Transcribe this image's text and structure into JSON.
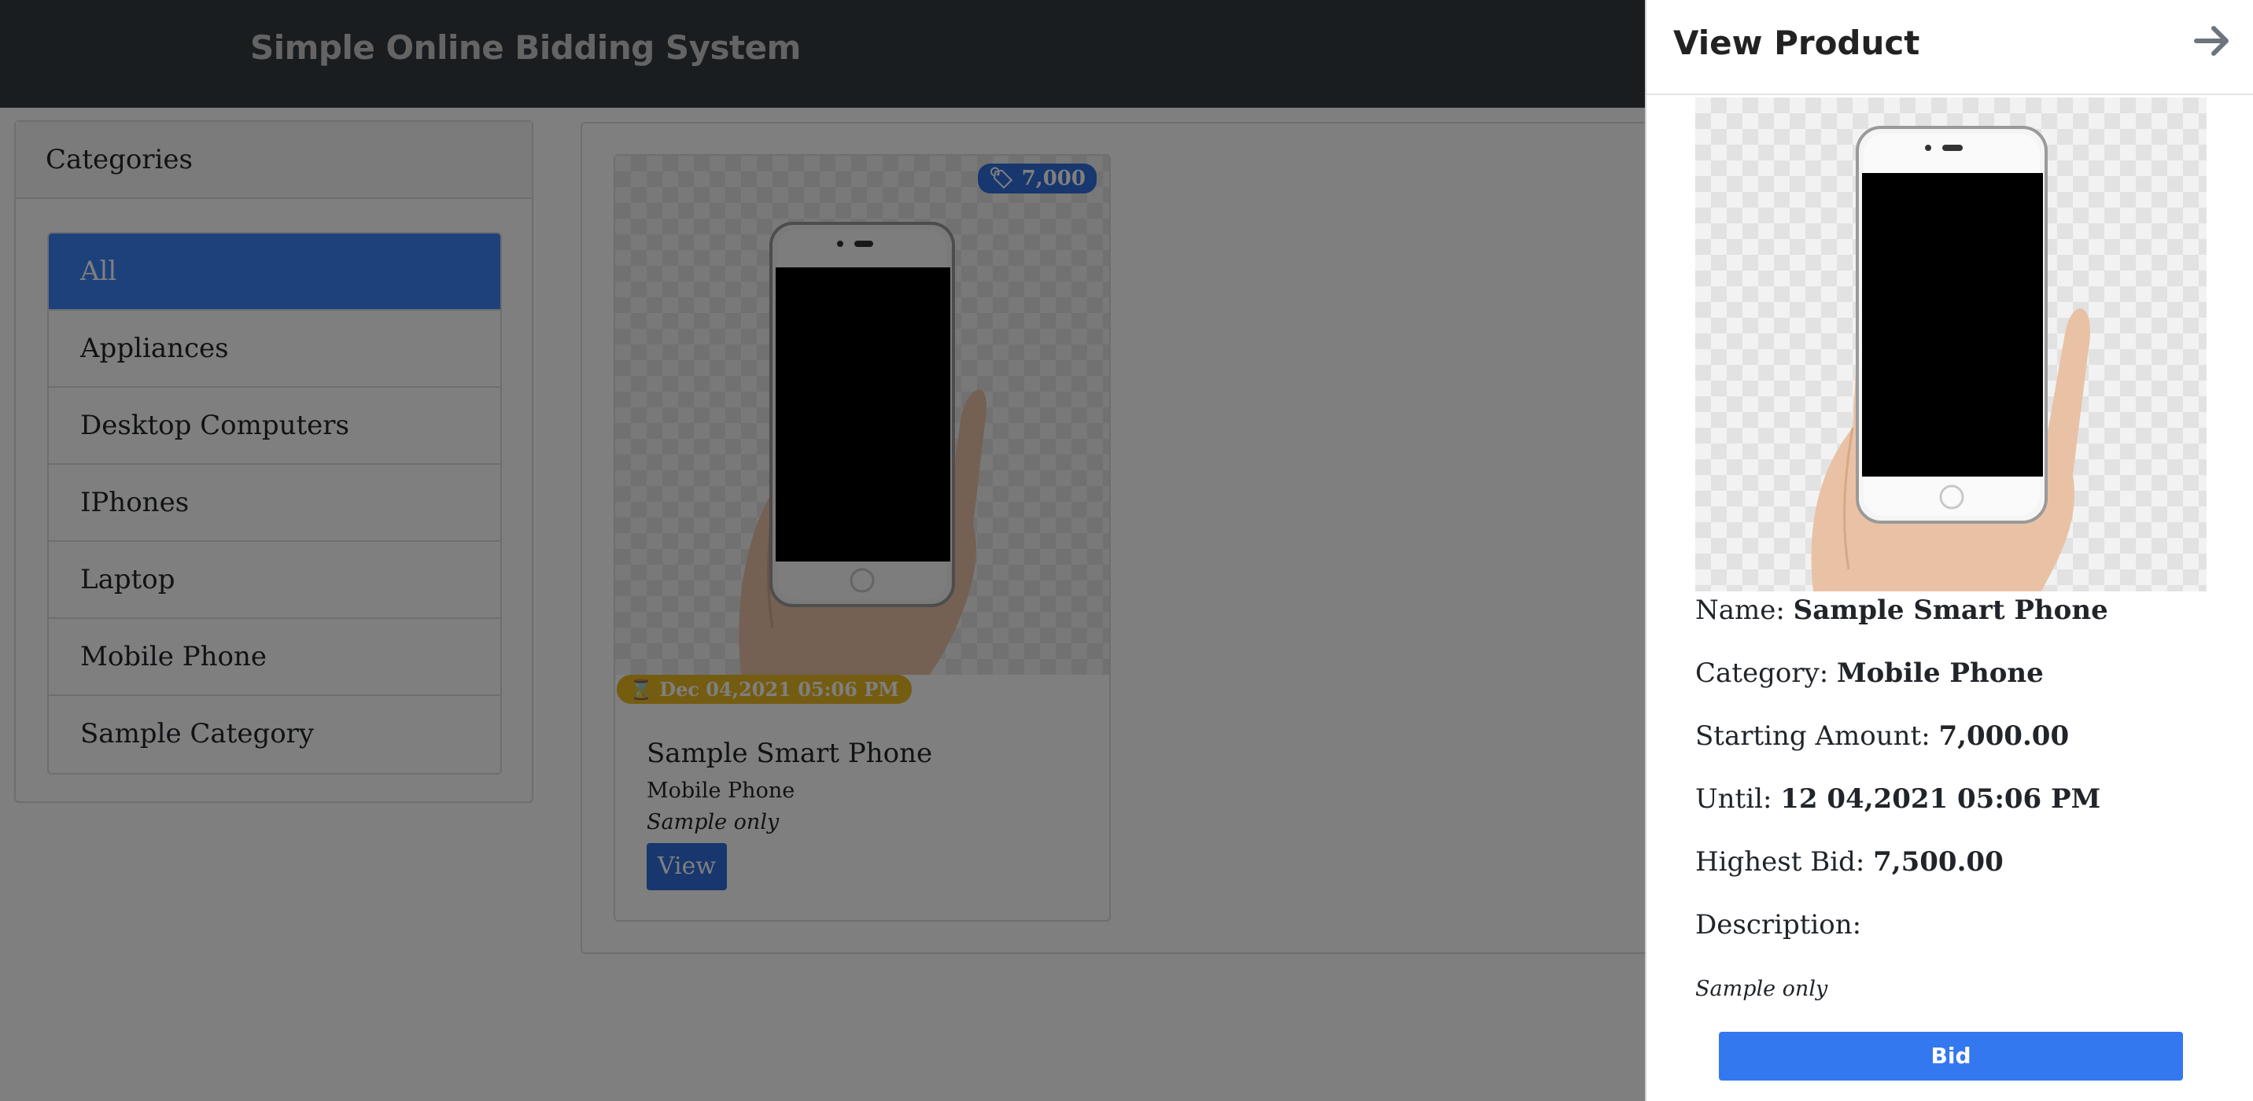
{
  "app": {
    "brand": "Simple Online Bidding System"
  },
  "categories": {
    "title": "Categories",
    "items": [
      {
        "label": "All",
        "active": true
      },
      {
        "label": "Appliances"
      },
      {
        "label": "Desktop Computers"
      },
      {
        "label": "IPhones"
      },
      {
        "label": "Laptop"
      },
      {
        "label": "Mobile Phone"
      },
      {
        "label": "Sample Category"
      }
    ]
  },
  "product_card": {
    "price_badge": "7,000",
    "date_badge": "Dec 04,2021 05:06 PM",
    "name": "Sample Smart Phone",
    "category": "Mobile Phone",
    "description": "Sample only",
    "view_label": "View",
    "image_icon": "phone-in-hand"
  },
  "panel": {
    "title": "View Product",
    "close_icon": "arrow-right",
    "name_label": "Name:",
    "name_value": "Sample Smart Phone",
    "category_label": "Category:",
    "category_value": "Mobile Phone",
    "starting_label": "Starting Amount:",
    "starting_value": "7,000.00",
    "until_label": "Until:",
    "until_value": "12 04,2021 05:06 PM",
    "highest_label": "Highest Bid:",
    "highest_value": "7,500.00",
    "description_label": "Description:",
    "description_value": "Sample only",
    "bid_label": "Bid"
  },
  "colors": {
    "navbar": "#343a40",
    "primary": "#3b82f6",
    "warning": "#e8b923",
    "overlay": "rgba(0,0,0,0.5)"
  }
}
